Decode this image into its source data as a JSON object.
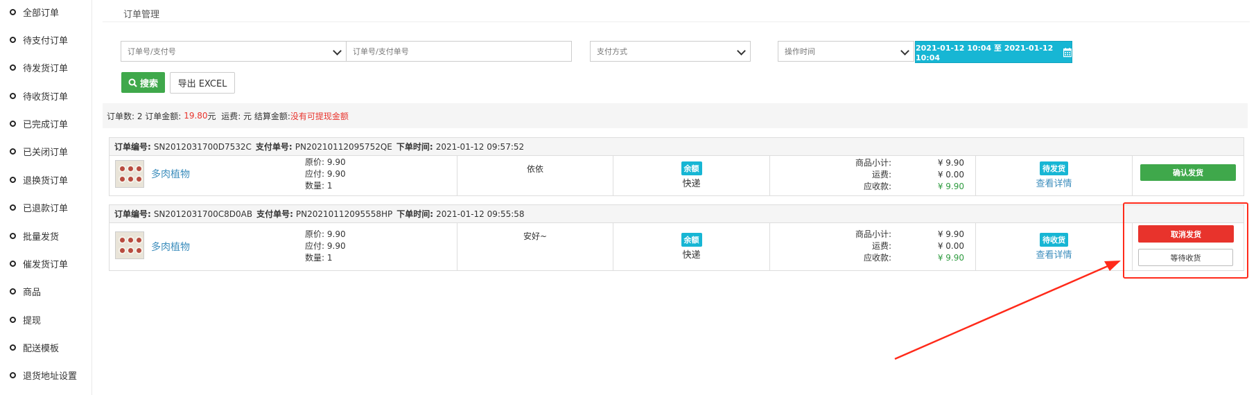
{
  "sidebar": {
    "items": [
      {
        "label": "全部订单"
      },
      {
        "label": "待支付订单"
      },
      {
        "label": "待发货订单"
      },
      {
        "label": "待收货订单"
      },
      {
        "label": "已完成订单"
      },
      {
        "label": "已关闭订单"
      },
      {
        "label": "退换货订单"
      },
      {
        "label": "已退款订单"
      },
      {
        "label": "批量发货"
      },
      {
        "label": "催发货订单"
      },
      {
        "label": "商品"
      },
      {
        "label": "提现"
      },
      {
        "label": "配送模板"
      },
      {
        "label": "退货地址设置"
      }
    ]
  },
  "page_title": "订单管理",
  "filters": {
    "order_type_select": "订单号/支付号",
    "order_input_placeholder": "订单号/支付单号",
    "payment_select": "支付方式",
    "time_select": "操作时间",
    "date_range": "2021-01-12 10:04 至 2021-01-12 10:04",
    "search_label": "搜索",
    "export_label": "导出 EXCEL"
  },
  "summary": {
    "count_label": "订单数: 2 订单金额:",
    "amount": "19.80",
    "amount_unit": "元",
    "freight_label": "运费: 元 结算金额:",
    "no_withdraw": "没有可提现金额"
  },
  "labels": {
    "order_no": "订单编号:",
    "pay_no": "支付单号:",
    "order_time": "下单时间:",
    "subtotal": "商品小计:",
    "freight": "运费:",
    "receivable": "应收款:",
    "original_price": "原价:",
    "payable": "应付:",
    "quantity": "数量:",
    "view_detail": "查看详情"
  },
  "orders": [
    {
      "order_no": "SN2012031700D7532C",
      "pay_no": "PN20210112095752QE",
      "time": "2021-01-12 09:57:52",
      "product": "多肉植物",
      "original_price": "9.90",
      "payable": "9.90",
      "quantity": "1",
      "note": "依依",
      "pay_method": "余额",
      "shipping": "快递",
      "subtotal": "¥ 9.90",
      "freight": "¥ 0.00",
      "receivable": "¥ 9.90",
      "status": "待发货",
      "action_primary": "确认发货"
    },
    {
      "order_no": "SN2012031700C8D0AB",
      "pay_no": "PN20210112095558HP",
      "time": "2021-01-12 09:55:58",
      "product": "多肉植物",
      "original_price": "9.90",
      "payable": "9.90",
      "quantity": "1",
      "note": "安好~",
      "pay_method": "余额",
      "shipping": "快递",
      "subtotal": "¥ 9.90",
      "freight": "¥ 0.00",
      "receivable": "¥ 9.90",
      "status": "待收货",
      "action_primary": "取消发货",
      "action_secondary": "等待收货"
    }
  ],
  "colors": {
    "accent_green": "#3fa84b",
    "accent_cyan": "#17b6d4",
    "danger_red": "#e8332c",
    "link_blue": "#3c8dbc",
    "annotation_red": "#ff2a1a"
  }
}
